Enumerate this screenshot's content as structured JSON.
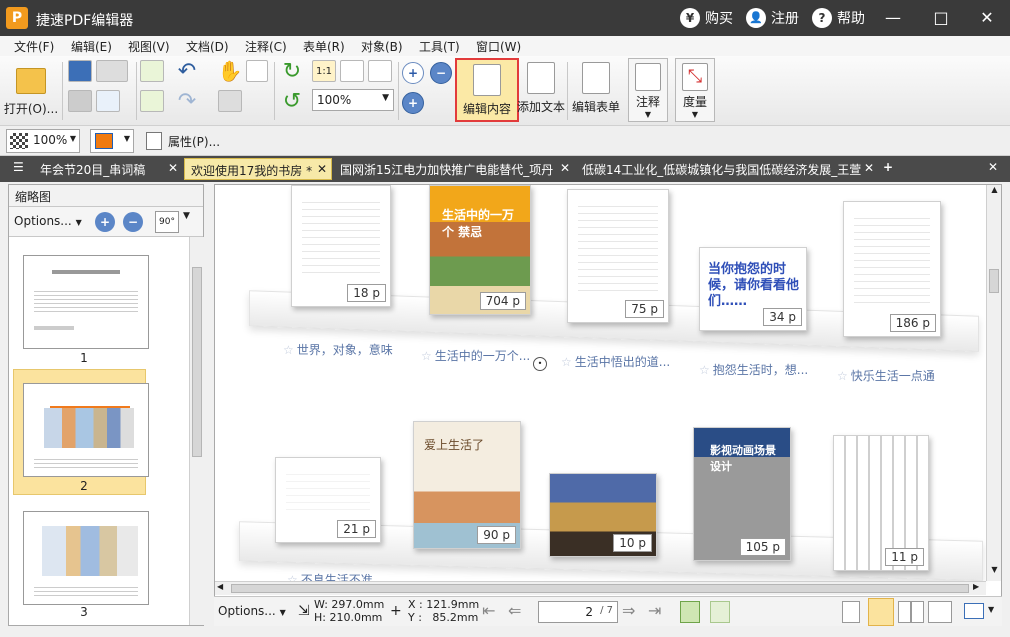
{
  "app": {
    "title": "捷速PDF编辑器",
    "icon_letter": "P"
  },
  "titlelinks": {
    "buy": "购买",
    "register": "注册",
    "help": "帮助",
    "buy_icon": "¥",
    "reg_icon": "👤",
    "help_icon": "?"
  },
  "menu": [
    "文件(F)",
    "编辑(E)",
    "视图(V)",
    "文档(D)",
    "注释(C)",
    "表单(R)",
    "对象(B)",
    "工具(T)",
    "窗口(W)"
  ],
  "toolbar": {
    "open": "打开(O)...",
    "zoom": "100%",
    "edit_content": "编辑内容",
    "add_text": "添加文本",
    "edit_form": "编辑表单",
    "annotate": "注释",
    "measure": "度量",
    "ratio_label": "1:1"
  },
  "propbar": {
    "zoom": "100%",
    "properties": "属性(P)..."
  },
  "tabs": [
    {
      "label": "年会节20目_串词稿",
      "active": false
    },
    {
      "label": "欢迎使用17我的书房 *",
      "active": true
    },
    {
      "label": "国网浙15江电力加快推广电能替代_项丹",
      "active": false
    },
    {
      "label": "低碳14工业化_低碳城镇化与我国低碳经济发展_王萱",
      "active": false
    }
  ],
  "thumbs": {
    "title": "缩略图",
    "options": "Options...",
    "rotate": "90°",
    "pages": [
      "1",
      "2",
      "3"
    ]
  },
  "shelf_top": {
    "books": [
      {
        "pages": "18 p"
      },
      {
        "pages": "704 p",
        "cover_title": "生活中的一万个 禁忌"
      },
      {
        "pages": "75 p"
      },
      {
        "pages": "34 p",
        "cover_text": "当你抱怨的时候，请你看看他们……"
      },
      {
        "pages": "186 p"
      }
    ],
    "captions": [
      "世界，对象，意味",
      "生活中的一万个...",
      "生活中悟出的道...",
      "抱怨生活时，想...",
      "快乐生活一点通"
    ]
  },
  "shelf_bottom": {
    "books": [
      {
        "pages": "21 p"
      },
      {
        "pages": "90 p",
        "cover_title": "爱上生活了"
      },
      {
        "pages": "10 p"
      },
      {
        "pages": "105 p",
        "cover_title": "影视动画场景设计"
      },
      {
        "pages": "11 p"
      }
    ],
    "captions": [
      "不息生活不准"
    ]
  },
  "status": {
    "options": "Options...",
    "width": "W: 297.0mm",
    "height": "H: 210.0mm",
    "x": "X : 121.9mm",
    "y": "Y :   85.2mm",
    "page": "2",
    "page_total": "/ 7"
  }
}
